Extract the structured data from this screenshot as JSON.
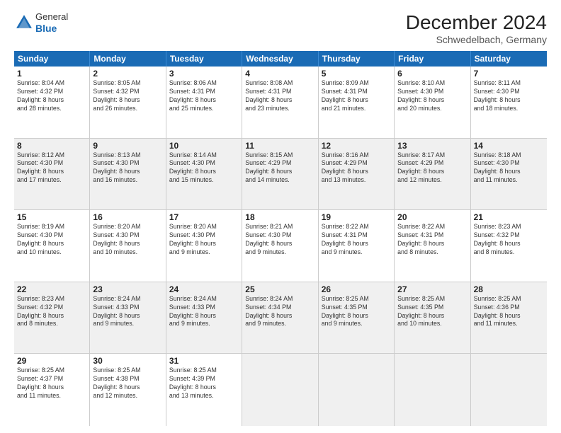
{
  "header": {
    "logo_general": "General",
    "logo_blue": "Blue",
    "month_year": "December 2024",
    "location": "Schwedelbach, Germany"
  },
  "days_of_week": [
    "Sunday",
    "Monday",
    "Tuesday",
    "Wednesday",
    "Thursday",
    "Friday",
    "Saturday"
  ],
  "weeks": [
    [
      {
        "day": "1",
        "text": "Sunrise: 8:04 AM\nSunset: 4:32 PM\nDaylight: 8 hours\nand 28 minutes.",
        "shaded": false
      },
      {
        "day": "2",
        "text": "Sunrise: 8:05 AM\nSunset: 4:32 PM\nDaylight: 8 hours\nand 26 minutes.",
        "shaded": false
      },
      {
        "day": "3",
        "text": "Sunrise: 8:06 AM\nSunset: 4:31 PM\nDaylight: 8 hours\nand 25 minutes.",
        "shaded": false
      },
      {
        "day": "4",
        "text": "Sunrise: 8:08 AM\nSunset: 4:31 PM\nDaylight: 8 hours\nand 23 minutes.",
        "shaded": false
      },
      {
        "day": "5",
        "text": "Sunrise: 8:09 AM\nSunset: 4:31 PM\nDaylight: 8 hours\nand 21 minutes.",
        "shaded": false
      },
      {
        "day": "6",
        "text": "Sunrise: 8:10 AM\nSunset: 4:30 PM\nDaylight: 8 hours\nand 20 minutes.",
        "shaded": false
      },
      {
        "day": "7",
        "text": "Sunrise: 8:11 AM\nSunset: 4:30 PM\nDaylight: 8 hours\nand 18 minutes.",
        "shaded": false
      }
    ],
    [
      {
        "day": "8",
        "text": "Sunrise: 8:12 AM\nSunset: 4:30 PM\nDaylight: 8 hours\nand 17 minutes.",
        "shaded": true
      },
      {
        "day": "9",
        "text": "Sunrise: 8:13 AM\nSunset: 4:30 PM\nDaylight: 8 hours\nand 16 minutes.",
        "shaded": true
      },
      {
        "day": "10",
        "text": "Sunrise: 8:14 AM\nSunset: 4:30 PM\nDaylight: 8 hours\nand 15 minutes.",
        "shaded": true
      },
      {
        "day": "11",
        "text": "Sunrise: 8:15 AM\nSunset: 4:29 PM\nDaylight: 8 hours\nand 14 minutes.",
        "shaded": true
      },
      {
        "day": "12",
        "text": "Sunrise: 8:16 AM\nSunset: 4:29 PM\nDaylight: 8 hours\nand 13 minutes.",
        "shaded": true
      },
      {
        "day": "13",
        "text": "Sunrise: 8:17 AM\nSunset: 4:29 PM\nDaylight: 8 hours\nand 12 minutes.",
        "shaded": true
      },
      {
        "day": "14",
        "text": "Sunrise: 8:18 AM\nSunset: 4:30 PM\nDaylight: 8 hours\nand 11 minutes.",
        "shaded": true
      }
    ],
    [
      {
        "day": "15",
        "text": "Sunrise: 8:19 AM\nSunset: 4:30 PM\nDaylight: 8 hours\nand 10 minutes.",
        "shaded": false
      },
      {
        "day": "16",
        "text": "Sunrise: 8:20 AM\nSunset: 4:30 PM\nDaylight: 8 hours\nand 10 minutes.",
        "shaded": false
      },
      {
        "day": "17",
        "text": "Sunrise: 8:20 AM\nSunset: 4:30 PM\nDaylight: 8 hours\nand 9 minutes.",
        "shaded": false
      },
      {
        "day": "18",
        "text": "Sunrise: 8:21 AM\nSunset: 4:30 PM\nDaylight: 8 hours\nand 9 minutes.",
        "shaded": false
      },
      {
        "day": "19",
        "text": "Sunrise: 8:22 AM\nSunset: 4:31 PM\nDaylight: 8 hours\nand 9 minutes.",
        "shaded": false
      },
      {
        "day": "20",
        "text": "Sunrise: 8:22 AM\nSunset: 4:31 PM\nDaylight: 8 hours\nand 8 minutes.",
        "shaded": false
      },
      {
        "day": "21",
        "text": "Sunrise: 8:23 AM\nSunset: 4:32 PM\nDaylight: 8 hours\nand 8 minutes.",
        "shaded": false
      }
    ],
    [
      {
        "day": "22",
        "text": "Sunrise: 8:23 AM\nSunset: 4:32 PM\nDaylight: 8 hours\nand 8 minutes.",
        "shaded": true
      },
      {
        "day": "23",
        "text": "Sunrise: 8:24 AM\nSunset: 4:33 PM\nDaylight: 8 hours\nand 9 minutes.",
        "shaded": true
      },
      {
        "day": "24",
        "text": "Sunrise: 8:24 AM\nSunset: 4:33 PM\nDaylight: 8 hours\nand 9 minutes.",
        "shaded": true
      },
      {
        "day": "25",
        "text": "Sunrise: 8:24 AM\nSunset: 4:34 PM\nDaylight: 8 hours\nand 9 minutes.",
        "shaded": true
      },
      {
        "day": "26",
        "text": "Sunrise: 8:25 AM\nSunset: 4:35 PM\nDaylight: 8 hours\nand 9 minutes.",
        "shaded": true
      },
      {
        "day": "27",
        "text": "Sunrise: 8:25 AM\nSunset: 4:35 PM\nDaylight: 8 hours\nand 10 minutes.",
        "shaded": true
      },
      {
        "day": "28",
        "text": "Sunrise: 8:25 AM\nSunset: 4:36 PM\nDaylight: 8 hours\nand 11 minutes.",
        "shaded": true
      }
    ],
    [
      {
        "day": "29",
        "text": "Sunrise: 8:25 AM\nSunset: 4:37 PM\nDaylight: 8 hours\nand 11 minutes.",
        "shaded": false
      },
      {
        "day": "30",
        "text": "Sunrise: 8:25 AM\nSunset: 4:38 PM\nDaylight: 8 hours\nand 12 minutes.",
        "shaded": false
      },
      {
        "day": "31",
        "text": "Sunrise: 8:25 AM\nSunset: 4:39 PM\nDaylight: 8 hours\nand 13 minutes.",
        "shaded": false
      },
      {
        "day": "",
        "text": "",
        "shaded": true,
        "empty": true
      },
      {
        "day": "",
        "text": "",
        "shaded": true,
        "empty": true
      },
      {
        "day": "",
        "text": "",
        "shaded": true,
        "empty": true
      },
      {
        "day": "",
        "text": "",
        "shaded": true,
        "empty": true
      }
    ]
  ]
}
